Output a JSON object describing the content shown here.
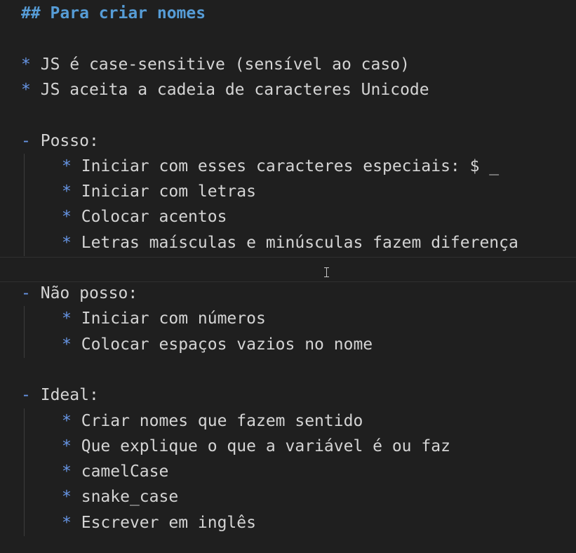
{
  "editor": {
    "heading": "## Para criar nomes",
    "top_items": [
      "JS é case-sensitive (sensível ao caso)",
      "JS aceita a cadeia de caracteres Unicode"
    ],
    "bullet_marker": "*",
    "group_marker": "-",
    "groups": [
      {
        "label": "Posso:",
        "items": [
          "Iniciar com esses caracteres especiais: $ _",
          "Iniciar com letras",
          "Colocar acentos",
          "Letras maísculas e minúsculas fazem diferença"
        ]
      },
      {
        "label": "Não posso:",
        "items": [
          "Iniciar com números",
          "Colocar espaços vazios no nome"
        ]
      },
      {
        "label": "Ideal:",
        "items": [
          "Criar nomes que fazem sentido",
          "Que explique o que a variável é ou faz",
          "camelCase",
          "snake_case",
          "Escrever em inglês"
        ]
      }
    ]
  }
}
